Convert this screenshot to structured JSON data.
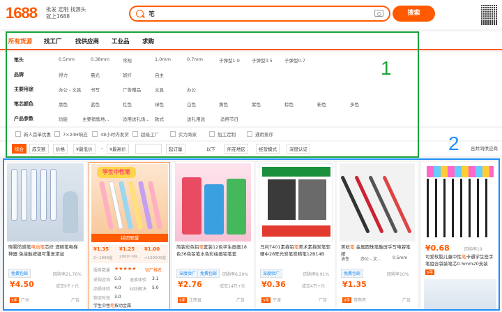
{
  "header": {
    "logo_text": "1688",
    "slogan_line1": "批发 定制 找源头",
    "slogan_line2": "就上1688",
    "search_value": "笔",
    "search_button": "搜索"
  },
  "categories": [
    "所有货源",
    "找工厂",
    "找供应商",
    "工业品",
    "求购"
  ],
  "filters": [
    {
      "label": "笔头",
      "options": [
        "0.5mm",
        "0.38mm",
        "常规",
        "1.0mm",
        "0.7mm",
        "子弹型1.0",
        "子弹型0.5",
        "子弹型0.7"
      ]
    },
    {
      "label": "品牌",
      "options": [
        "得力",
        "晨光",
        "斑纤",
        "自主"
      ]
    },
    {
      "label": "主要用途",
      "options": [
        "办公 - 文具",
        "书写",
        "广告赠品",
        "文具",
        "办公"
      ]
    },
    {
      "label": "笔芯颜色",
      "options": [
        "黑色",
        "蓝色",
        "红色",
        "绿色",
        "白色",
        "黄色",
        "紫色",
        "棕色",
        "粉色",
        "多色"
      ]
    },
    {
      "label": "产品参数",
      "options": [
        "功能",
        "主要销售地...",
        "适用送礼场...",
        "款式",
        "送礼用途",
        "适用节日"
      ]
    }
  ],
  "checkboxes": [
    "新人首单优惠",
    "7×24H响应",
    "48小时内发货",
    "超级工厂",
    "实力商家",
    "加工定制",
    "通用排序"
  ],
  "sortbar": {
    "items": [
      "综合",
      "成交额",
      "价格",
      "¥最低价",
      "-",
      "¥最高价",
      "起订量",
      "以下",
      "所在地区",
      "经营模式",
      "深度认证"
    ],
    "right": "合并同供应商"
  },
  "annotations": {
    "box1": "1",
    "box2": "2"
  },
  "products": [
    {
      "title_pre": "晓雾防感笔",
      "title_hl": "电动笔",
      "title_post": "芯修 酒精笔电梯神器 免接触按键可重复添加",
      "tag": "免费包邮",
      "price": "¥4.50",
      "repurchase": "回购率21.76%",
      "sold": "成交9千+元",
      "years": "5年",
      "location": "广州",
      "ad": "广告"
    },
    {
      "title_pre": "学生中性",
      "title_hl": "笔",
      "title_post": "按动金属",
      "overlay": "拼团联盟",
      "price1": "¥1.35",
      "price2": "¥1.25",
      "price3": "¥1.00",
      "range1": "2~1999盒",
      "range2": "2000~99...",
      "range3": ">100000盒",
      "service_label": "服务数量",
      "rating": "★★★★★",
      "factory": "钻厂排名",
      "scores": [
        [
          "采购咨询",
          "5.0"
        ],
        [
          "退换体验",
          "3.1"
        ],
        [
          "品质体验",
          "4.0"
        ],
        [
          "纠纷解决",
          "5.0"
        ],
        [
          "物流时效",
          "3.0"
        ]
      ]
    },
    {
      "title_pre": "简装彩色铅",
      "title_hl": "笔",
      "title_post": "套装12色学生画画18色36色铅笔水色彩绘画铅笔套",
      "tag": "深度验厂",
      "tag2": "免费包邮",
      "price": "¥2.76",
      "repurchase": "回购率6.29%",
      "sold": "成交14万+元",
      "years": "9年",
      "location": "江西省",
      "ad": "广告"
    },
    {
      "title_pre": "马利7401素描铅",
      "title_hl": "笔",
      "title_post": "美术素描炭笔软硬中28旺光炭笔炭精笔12B14B",
      "tag": "深度验厂",
      "price": "¥0.36",
      "repurchase": "回购率8.91%",
      "sold": "成交4万+元",
      "years": "5年",
      "location": "宁波",
      "ad": "广告"
    },
    {
      "title_pre": "美松",
      "title_hl": "笔",
      "title_post": " 金属圆珠笔触屏手写电容笔按",
      "tag": "免费包邮",
      "price": "¥1.35",
      "repurchase": "回购率10%",
      "sold": "",
      "years": "8年",
      "location": "常熟市",
      "ad": "广告",
      "specs": [
        "油性",
        "办公 - 文...",
        "0.5mm"
      ]
    },
    {
      "title_pre": "可爱软胶儿童中性",
      "title_hl": "笔",
      "title_post": "卡通学生签字笔组合袋装笔芯0.5mm20支装",
      "price": "¥0.68",
      "repurchase": "回购率19",
      "years": "6年"
    }
  ]
}
